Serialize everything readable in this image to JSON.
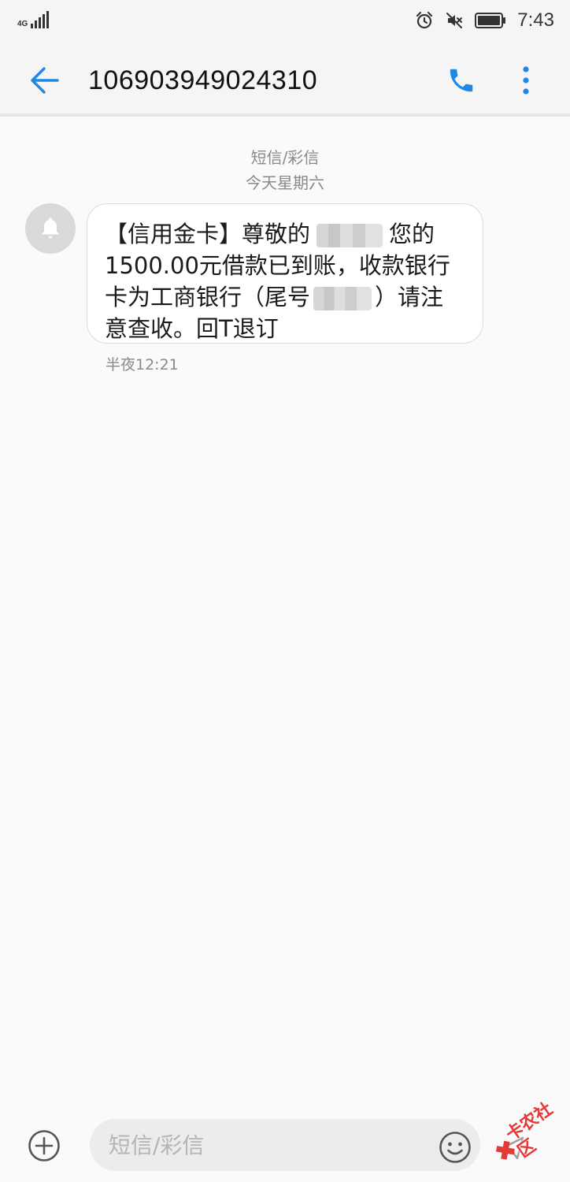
{
  "status_bar": {
    "network": "4G",
    "time": "7:43",
    "icons": [
      "signal-icon",
      "alarm-icon",
      "mute-icon",
      "battery-icon"
    ]
  },
  "header": {
    "title": "106903949024310",
    "icons": [
      "back-arrow-icon",
      "phone-icon",
      "more-vertical-icon"
    ]
  },
  "conversation": {
    "message_type": "短信/彩信",
    "date": "今天星期六",
    "messages": [
      {
        "avatar_icon": "bell-icon",
        "line1_start": "【信用金卡】尊敬的",
        "line1_end": "您的",
        "line2": "1500.00元借款已到账，收款银行",
        "line3_start": "卡为工商银行（尾号",
        "line3_end": "）请注",
        "line4": "意查收。回T退订",
        "time": "半夜12:21"
      }
    ]
  },
  "composer": {
    "placeholder": "短信/彩信",
    "icons": [
      "add-circle-icon",
      "emoji-icon",
      "send-icon"
    ]
  },
  "watermark": {
    "text": "卡农社区"
  },
  "colors": {
    "accent": "#1e88e5",
    "background": "#fafafa",
    "bar": "#f5f5f5",
    "bubble": "#ffffff",
    "muted_text": "#8a8a8a",
    "watermark": "#e53935"
  }
}
